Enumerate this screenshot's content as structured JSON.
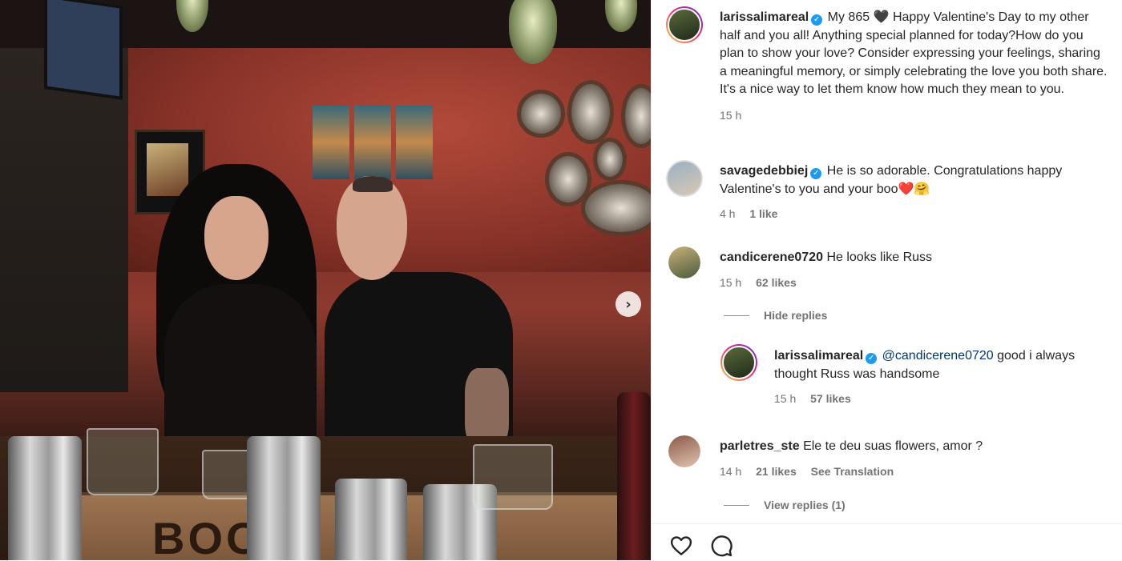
{
  "photo": {
    "crate_text": "BOO",
    "next_icon": "chevron-right-icon"
  },
  "post": {
    "username": "larissalimareal",
    "caption": "My 865 🖤 Happy Valentine's Day to my other half and you all! Anything special planned for today?How do you plan to show your love? Consider expressing your feelings, sharing a meaningful memory, or simply celebrating the love you both share. It's a nice way to let them know how much they mean to you.",
    "time": "15 h"
  },
  "comments": [
    {
      "username": "savagedebbiej",
      "verified": true,
      "text": "He is so adorable. Congratulations happy Valentine's to you and your boo❤️🤗",
      "time": "4 h",
      "likes": "1 like"
    },
    {
      "username": "candicerene0720",
      "verified": false,
      "text": "He looks like Russ",
      "time": "15 h",
      "likes": "62 likes",
      "replies_toggle": "Hide replies",
      "reply": {
        "username": "larissalimareal",
        "verified": true,
        "mention": "@candicerene0720",
        "text": " good i always thought Russ was handsome",
        "time": "15 h",
        "likes": "57 likes"
      }
    },
    {
      "username": "parletres_ste",
      "verified": false,
      "text": "Ele te deu suas flowers, amor ?",
      "time": "14 h",
      "likes": "21 likes",
      "see_translation": "See Translation",
      "replies_toggle": "View replies (1)"
    }
  ],
  "actions": {
    "like_icon": "heart-icon",
    "comment_icon": "comment-icon"
  },
  "colors": {
    "verified": "#1d9bf0",
    "mention": "#00376b",
    "meta": "#737373"
  }
}
